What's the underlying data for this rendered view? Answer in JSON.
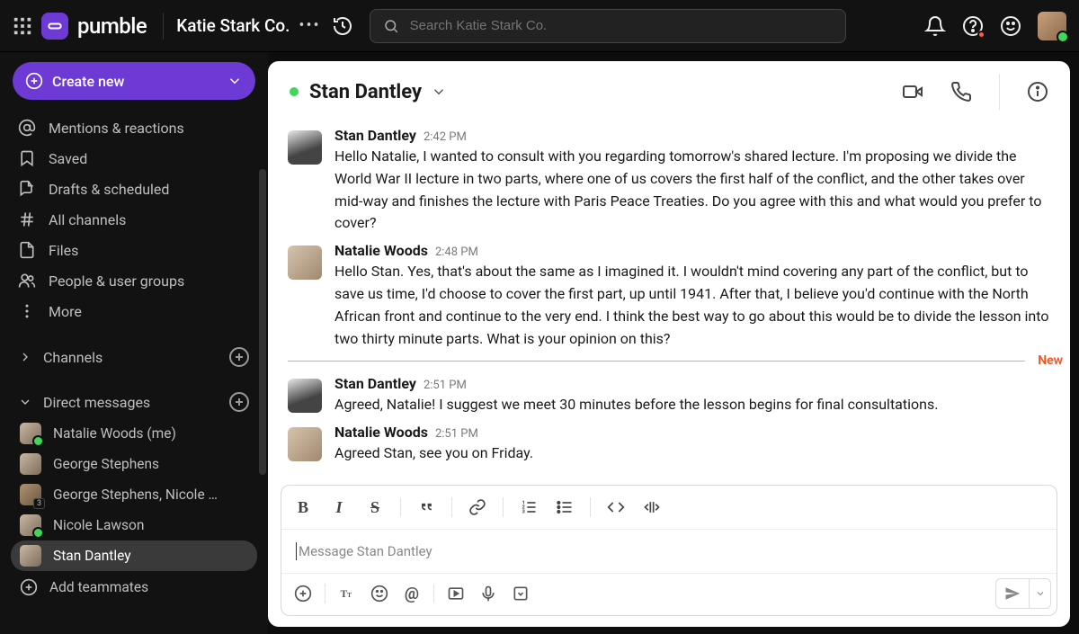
{
  "app": {
    "name": "pumble"
  },
  "org": {
    "name": "Katie Stark Co."
  },
  "search": {
    "placeholder": "Search Katie Stark Co."
  },
  "sidebar": {
    "create_label": "Create new",
    "nav": [
      {
        "icon": "mention-icon",
        "label": "Mentions & reactions"
      },
      {
        "icon": "bookmark-icon",
        "label": "Saved"
      },
      {
        "icon": "draft-icon",
        "label": "Drafts & scheduled"
      },
      {
        "icon": "hash-icon",
        "label": "All channels"
      },
      {
        "icon": "files-icon",
        "label": "Files"
      },
      {
        "icon": "people-icon",
        "label": "People & user groups"
      },
      {
        "icon": "more-icon",
        "label": "More"
      }
    ],
    "sections": {
      "channels": "Channels",
      "dms": "Direct messages"
    },
    "dms": [
      {
        "name": "Natalie Woods (me)",
        "presence": true,
        "group": false
      },
      {
        "name": "George Stephens",
        "presence": false,
        "group": false
      },
      {
        "name": "George Stephens, Nicole …",
        "presence": false,
        "group": true
      },
      {
        "name": "Nicole Lawson",
        "presence": true,
        "group": false
      },
      {
        "name": "Stan Dantley",
        "presence": false,
        "group": false,
        "active": true
      }
    ],
    "add_teammates": "Add teammates"
  },
  "conversation": {
    "title": "Stan Dantley",
    "new_label": "New",
    "messages": [
      {
        "author": "Stan Dantley",
        "time": "2:42 PM",
        "avatar": "b",
        "text": "Hello Natalie, I wanted to consult with you regarding tomorrow's shared lecture. I'm proposing we divide the World War II lecture in two parts, where one of us covers the first half of the conflict, and the other takes over mid-way and finishes the lecture with Paris Peace Treaties. Do you agree with this and what would you prefer to cover?"
      },
      {
        "author": "Natalie Woods",
        "time": "2:48 PM",
        "avatar": "a",
        "text": "Hello Stan. Yes, that's about the same as I imagined it. I wouldn't mind covering any part of the conflict, but to save us time, I'd choose to cover the first part, up until 1941. After that, I believe you'd continue with the North African front and continue to the very end. I think the best way to go about this would be to divide the lesson into two thirty minute parts. What is your opinion on this?"
      },
      {
        "author": "Stan Dantley",
        "time": "2:51 PM",
        "avatar": "b",
        "text": "Agreed, Natalie! I suggest we meet 30 minutes before the lesson begins for final consultations."
      },
      {
        "author": "Natalie Woods",
        "time": "2:51 PM",
        "avatar": "a",
        "text": "Agreed Stan, see you on Friday."
      }
    ],
    "composer_placeholder": "Message Stan Dantley"
  }
}
